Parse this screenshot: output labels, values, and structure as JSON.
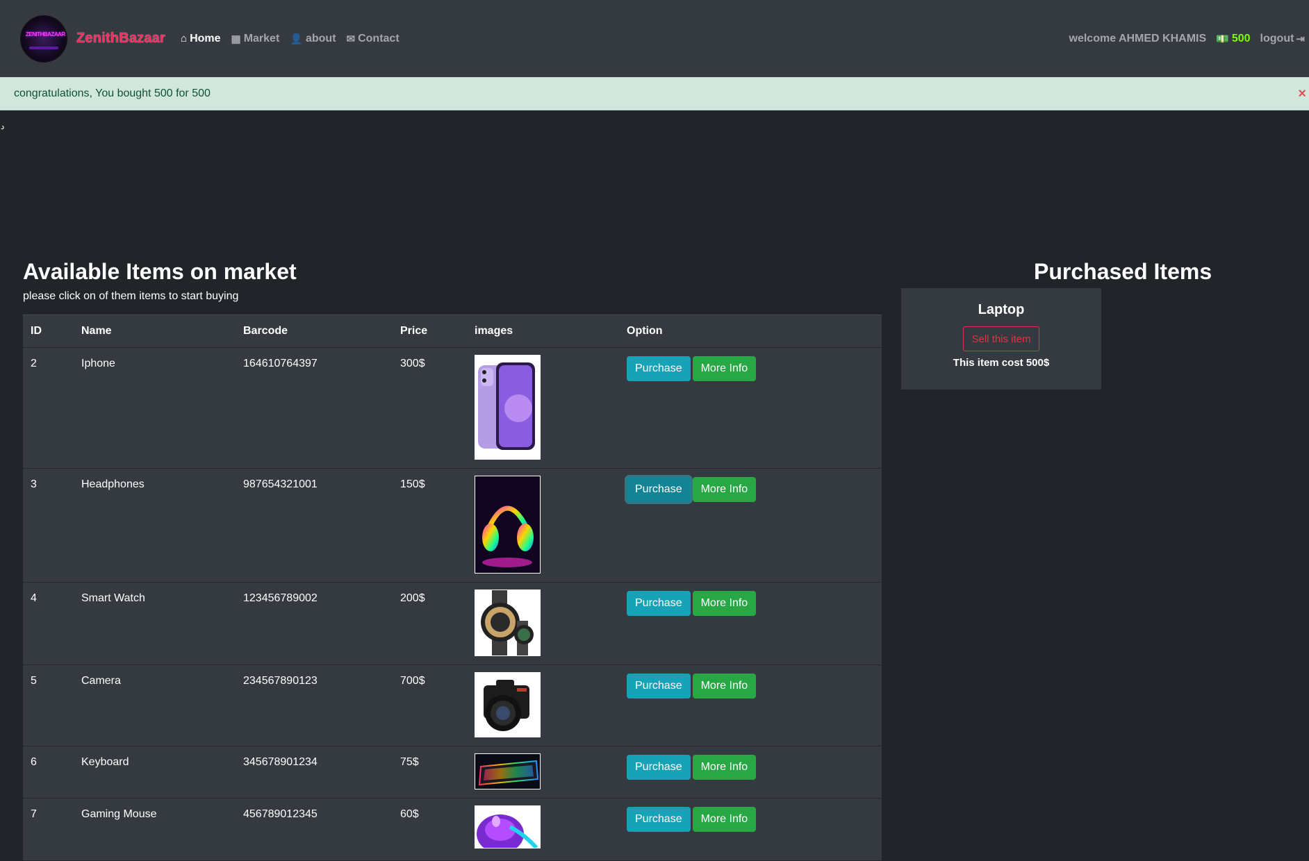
{
  "nav": {
    "brand": "ZenithBazaar",
    "logo_text": "ZENITHBAZAAR",
    "links": [
      {
        "label": "Home",
        "icon": "home-icon",
        "active": true
      },
      {
        "label": "Market",
        "icon": "table-icon",
        "active": false
      },
      {
        "label": "about",
        "icon": "user-icon",
        "active": false
      },
      {
        "label": "Contact",
        "icon": "envelope-icon",
        "active": false
      }
    ],
    "welcome": "welcome AHMED KHAMIS",
    "budget": "500",
    "budget_icon": "money-icon",
    "logout": "logout",
    "logout_icon": "sign-out-icon"
  },
  "alert": {
    "message": "congratulations, You bought 500 for 500",
    "close": "×"
  },
  "stray_char": "د",
  "market": {
    "title": "Available Items on market",
    "subtitle": "please click on of them items to start buying",
    "columns": [
      "ID",
      "Name",
      "Barcode",
      "Price",
      "images",
      "Option"
    ],
    "purchase_label": "Purchase",
    "info_label": "More Info",
    "rows": [
      {
        "id": "2",
        "name": "Iphone",
        "barcode": "164610764397",
        "price": "300$"
      },
      {
        "id": "3",
        "name": "Headphones",
        "barcode": "987654321001",
        "price": "150$"
      },
      {
        "id": "4",
        "name": "Smart Watch",
        "barcode": "123456789002",
        "price": "200$"
      },
      {
        "id": "5",
        "name": "Camera",
        "barcode": "234567890123",
        "price": "700$"
      },
      {
        "id": "6",
        "name": "Keyboard",
        "barcode": "345678901234",
        "price": "75$"
      },
      {
        "id": "7",
        "name": "Gaming Mouse",
        "barcode": "456789012345",
        "price": "60$"
      }
    ]
  },
  "purchased": {
    "title": "Purchased Items",
    "items": [
      {
        "name": "Laptop",
        "sell_label": "Sell this item",
        "cost": "This item cost 500$"
      }
    ]
  },
  "colors": {
    "navbar": "#343a40",
    "background": "#212529",
    "brand": "#ff2a5f",
    "budget": "#7cfc00",
    "alert_bg": "#d1e7dd",
    "purchase": "#17a2b8",
    "info": "#28a745",
    "danger": "#dc3545"
  }
}
